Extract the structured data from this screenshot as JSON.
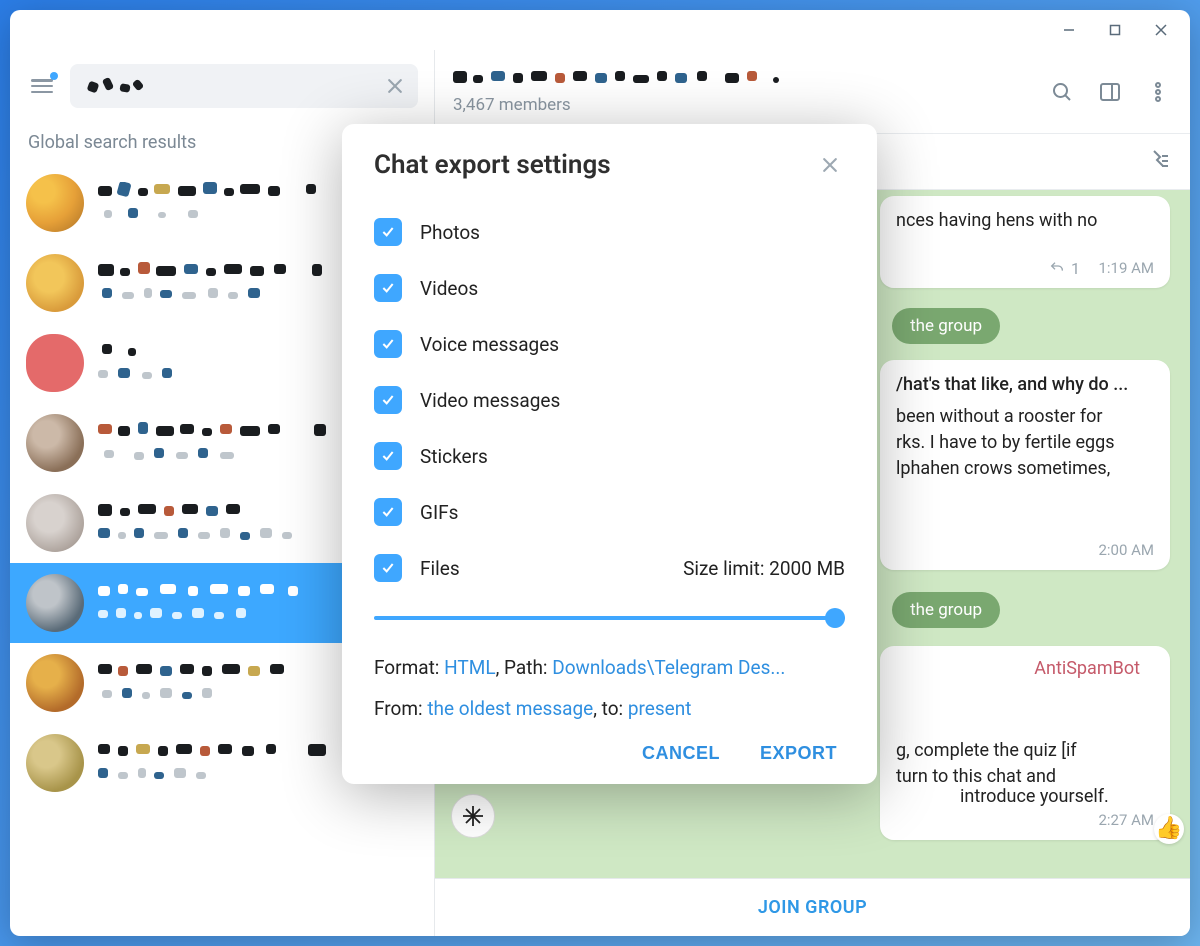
{
  "titlebar": {},
  "sidebar": {
    "search_value": "",
    "section_label": "Global search results"
  },
  "header": {
    "members": "3,467 members"
  },
  "messages": {
    "m1_text": "nces having hens with no",
    "m1_reply_count": "1",
    "m1_time": "1:19 AM",
    "sys1": "the group",
    "m2_line1": "/hat's that like, and why do ...",
    "m2_line2": "been without a rooster for",
    "m2_line3": "rks. I have to by fertile eggs",
    "m2_line4": "lphahen crows sometimes,",
    "m2_time": "2:00 AM",
    "sys2": "the group",
    "m3_name": "AntiSpamBot",
    "m3_line1": "g, complete the quiz [if",
    "m3_line2": "turn to this chat and",
    "m3_line3": "introduce yourself.",
    "m3_time": "2:27 AM"
  },
  "joinbar": {
    "label": "JOIN GROUP"
  },
  "modal": {
    "title": "Chat export settings",
    "options": {
      "photos": "Photos",
      "videos": "Videos",
      "voice": "Voice messages",
      "videomsg": "Video messages",
      "stickers": "Stickers",
      "gifs": "GIFs",
      "files": "Files"
    },
    "size_limit": "Size limit: 2000 MB",
    "format_label": "Format: ",
    "format_value": "HTML",
    "path_label": ", Path: ",
    "path_value": "Downloads\\Telegram Des...",
    "from_label": "From: ",
    "from_value": "the oldest message",
    "to_label": ", to: ",
    "to_value": "present",
    "cancel": "CANCEL",
    "export": "EXPORT"
  }
}
